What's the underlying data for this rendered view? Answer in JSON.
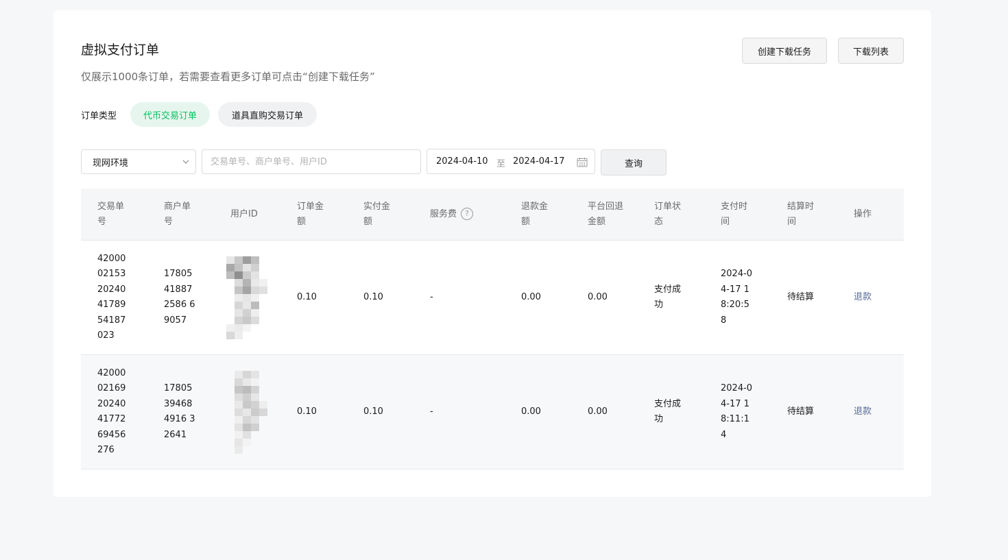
{
  "header": {
    "title": "虚拟支付订单",
    "subtitle": "仅展示1000条订单，若需要查看更多订单可点击“创建下载任务”",
    "create_task_label": "创建下载任务",
    "download_list_label": "下载列表"
  },
  "order_type": {
    "label": "订单类型",
    "options": [
      "代币交易订单",
      "道具直购交易订单"
    ],
    "active_index": 0
  },
  "filters": {
    "environment": "现网环境",
    "search_placeholder": "交易单号、商户单号、用户ID",
    "date_start": "2024-04-10",
    "date_sep": "至",
    "date_end": "2024-04-17",
    "query_label": "查询"
  },
  "table": {
    "columns": [
      "交易单号",
      "商户单号",
      "用户ID",
      "订单金额",
      "实付金额",
      "服务费",
      "退款金额",
      "平台回退金额",
      "订单状态",
      "支付时间",
      "结算时间",
      "操作"
    ],
    "rows": [
      {
        "trade_no": "4200002153202404178954187023",
        "merchant_no": "17805418872586 69057",
        "user_id": "",
        "order_amount": "0.10",
        "paid_amount": "0.10",
        "service_fee": "-",
        "refund_amount": "0.00",
        "platform_refund": "0.00",
        "status": "支付成功",
        "pay_time": "2024-04-17 18:20:58",
        "settle_time": "待结算",
        "action": "退款"
      },
      {
        "trade_no": "4200002169202404177269456276",
        "merchant_no": "17805394684916 32641",
        "user_id": "",
        "order_amount": "0.10",
        "paid_amount": "0.10",
        "service_fee": "-",
        "refund_amount": "0.00",
        "platform_refund": "0.00",
        "status": "支付成功",
        "pay_time": "2024-04-17 18:11:14",
        "settle_time": "待结算",
        "action": "退款"
      }
    ]
  },
  "colors": {
    "accent": "#07c160",
    "link": "#576b95"
  }
}
